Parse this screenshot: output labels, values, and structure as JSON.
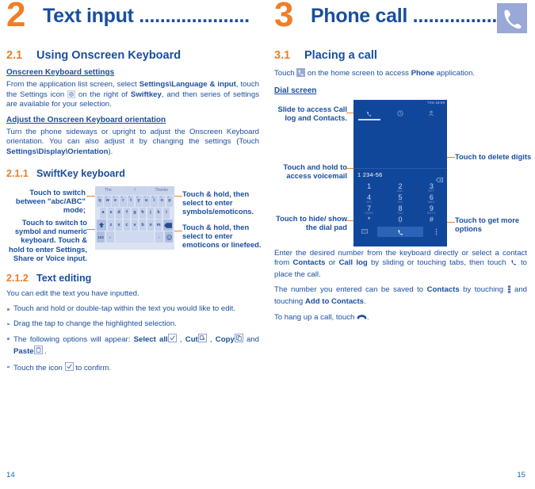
{
  "left_page": {
    "chapter": {
      "number": "2",
      "title": "Text input ....................."
    },
    "section": {
      "number": "2.1",
      "title": "Using Onscreen Keyboard"
    },
    "settings_heading": "Onscreen Keyboard settings",
    "settings_p1a": "From the application list screen, select ",
    "settings_b1": "Settings\\Language & input",
    "settings_p1b": ", touch the Settings icon ",
    "settings_p1c": " on the right of ",
    "settings_b2": "Swiftkey",
    "settings_p1d": ", and then series of settings are available for your selection.",
    "orientation_heading": "Adjust the Onscreen Keyboard orientation",
    "orientation_p1": "Turn the phone sideways or upright to adjust the Onscreen Keyboard orientation. You can also adjust it by changing the settings (Touch ",
    "orientation_b1": "Settings\\Display\\Orientation",
    "orientation_p2": ").",
    "subsection_1": {
      "number": "2.1.1",
      "title": "SwiftKey keyboard"
    },
    "keyboard": {
      "suggestions": [
        "The",
        "I",
        "Thanks"
      ],
      "row1": [
        "q",
        "w",
        "e",
        "r",
        "t",
        "y",
        "u",
        "i",
        "o",
        "p"
      ],
      "row1_nums": [
        "1",
        "2",
        "3",
        "4",
        "5",
        "6",
        "7",
        "8",
        "9",
        "0"
      ],
      "row2": [
        "a",
        "s",
        "d",
        "f",
        "g",
        "h",
        "j",
        "k",
        "l"
      ],
      "row3": [
        "z",
        "x",
        "c",
        "v",
        "b",
        "n",
        "m"
      ],
      "shift_key": "shift-key",
      "backspace_key": "backspace-key",
      "symbol_key": "123",
      "comma_key": ",",
      "period_key": ".",
      "emoji_key": "emoji-key",
      "space_key": "space-key"
    },
    "annotations": {
      "left_top": "Touch to switch between \"abc/ABC\" mode;",
      "left_bottom": "Touch to switch to symbol and numeric keyboard. Touch & hold  to enter Settings, Share or Voice input.",
      "right_top": "Touch & hold, then select to enter symbols/emoticons.",
      "right_bottom": "Touch & hold, then select to enter emoticons or linefeed."
    },
    "subsection_2": {
      "number": "2.1.2",
      "title": "Text editing"
    },
    "edit_intro": "You can edit the text you have inputted.",
    "bullet1": "Touch and hold or double-tap within the text you would like to edit.",
    "bullet2": "Drag the tap to change the highlighted selection.",
    "bullet3": {
      "a": "The following options will appear: ",
      "select_all": "Select all",
      "b": " , ",
      "cut": "Cut",
      "c": " , ",
      "copy": "Copy",
      "d": " and ",
      "paste": "Paste",
      "e": " ."
    },
    "bullet4": {
      "a": "Touch the icon ",
      "b": " to confirm."
    },
    "page_number": "14"
  },
  "right_page": {
    "chapter": {
      "number": "3",
      "title": "Phone call ................",
      "icon": "phone-handset-icon"
    },
    "section": {
      "number": "3.1",
      "title": "Placing a call"
    },
    "intro": {
      "a": "Touch ",
      "b": " on the home screen to access ",
      "bold": "Phone",
      "c": " application."
    },
    "dial_heading": "Dial screen",
    "phone_screen": {
      "status_left": "",
      "status_right": "71% 16:59",
      "tabs": [
        "dialer-tab",
        "call-log-tab",
        "contacts-tab"
      ],
      "number_value": "1 234-56",
      "delete_icon": "backspace-icon",
      "keys": [
        {
          "digit": "1",
          "sub": ""
        },
        {
          "digit": "2",
          "sub": "ABC"
        },
        {
          "digit": "3",
          "sub": "DEF"
        },
        {
          "digit": "4",
          "sub": "GHI"
        },
        {
          "digit": "5",
          "sub": "JKL"
        },
        {
          "digit": "6",
          "sub": "MNO"
        },
        {
          "digit": "7",
          "sub": "PQRS"
        },
        {
          "digit": "8",
          "sub": "TUV"
        },
        {
          "digit": "9",
          "sub": "WXYZ"
        },
        {
          "digit": "*",
          "sub": ""
        },
        {
          "digit": "0",
          "sub": "+"
        },
        {
          "digit": "#",
          "sub": ""
        }
      ],
      "hide_pad_icon": "hide-dialpad-icon",
      "call_icon": "call-icon",
      "more_icon": "more-options-icon"
    },
    "annotations": {
      "slide_access_a": "Slide to access ",
      "slide_access_b": "Call log",
      "slide_access_c": " and ",
      "slide_access_d": "Contacts",
      "slide_access_e": ".",
      "voicemail": "Touch and hold to access voicemail",
      "hide_show": "Touch to hide/ show the dial pad",
      "delete_digits": "Touch to delete digits",
      "more_options": "Touch to get more options"
    },
    "para1": {
      "a": "Enter the desired number from the keyboard directly or select a contact from ",
      "b": "Contacts",
      "c": " or ",
      "d": "Call log",
      "e": " by sliding or touching tabs, then touch ",
      "f": " to place the call."
    },
    "para2": {
      "a": "The number you entered can be saved to ",
      "b": "Contacts",
      "c": " by touching ",
      "d": " and touching ",
      "e": "Add to Contacts",
      "f": "."
    },
    "para3": {
      "a": "To hang up a call, touch ",
      "b": "."
    },
    "page_number": "15"
  },
  "colors": {
    "blue": "#1a4e9e",
    "orange": "#f07d28",
    "phone_dark_blue": "#11479b",
    "icon_lavender": "#9aa8d8"
  }
}
